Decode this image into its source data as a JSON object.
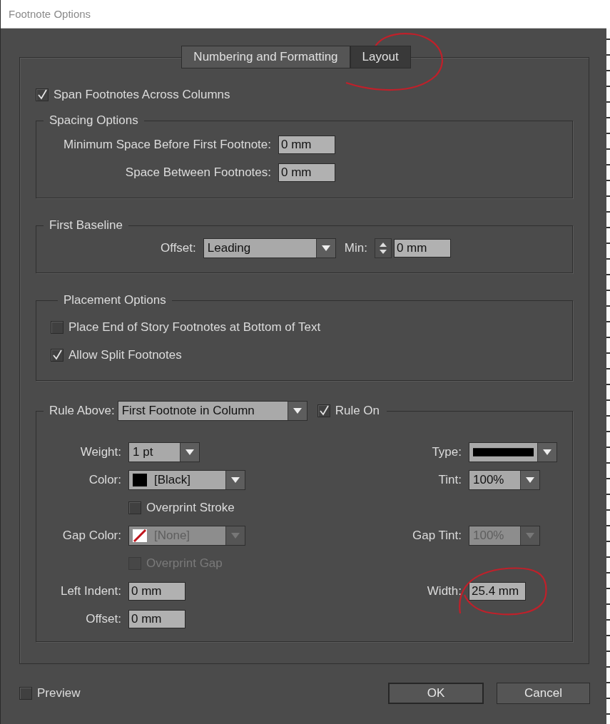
{
  "window": {
    "title": "Footnote Options"
  },
  "tabs": [
    {
      "label": "Numbering and Formatting",
      "selected": false
    },
    {
      "label": "Layout",
      "selected": true
    }
  ],
  "span_footnotes": {
    "label": "Span Footnotes Across Columns",
    "checked": true
  },
  "spacing_options": {
    "title": "Spacing Options",
    "fields": [
      {
        "label": "Minimum Space Before First Footnote:",
        "value": "0 mm"
      },
      {
        "label": "Space Between Footnotes:",
        "value": "0 mm"
      }
    ]
  },
  "first_baseline": {
    "title": "First Baseline",
    "offset": {
      "label": "Offset:",
      "value": "Leading"
    },
    "min": {
      "label": "Min:",
      "value": "0 mm"
    }
  },
  "placement_options": {
    "title": "Placement Options",
    "checkboxes": [
      {
        "label": "Place End of Story Footnotes at Bottom of Text",
        "checked": false
      },
      {
        "label": "Allow Split Footnotes",
        "checked": true
      }
    ]
  },
  "rule_above": {
    "label": "Rule Above:",
    "value": "First Footnote in Column",
    "rule_on": {
      "label": "Rule On",
      "checked": true
    },
    "rows": [
      {
        "left": {
          "kind": "dropdown",
          "label": "Weight:",
          "value": "1 pt",
          "disabled": false
        },
        "right": {
          "kind": "line-dropdown",
          "label": "Type:",
          "disabled": false
        }
      },
      {
        "left": {
          "kind": "dropdown",
          "label": "Color:",
          "value": "[Black]",
          "color": "#000000",
          "disabled": false
        },
        "right": {
          "kind": "dropdown",
          "label": "Tint:",
          "value": "100%",
          "disabled": false
        }
      },
      {
        "left": {
          "kind": "checkbox",
          "label": "Overprint Stroke",
          "checked": false,
          "disabled": false
        }
      },
      {
        "left": {
          "kind": "dropdown",
          "label": "Gap Color:",
          "value": "[None]",
          "swatch_none": true,
          "disabled": true
        },
        "right": {
          "kind": "dropdown",
          "label": "Gap Tint:",
          "value": "100%",
          "disabled": true
        }
      },
      {
        "left": {
          "kind": "checkbox",
          "label": "Overprint Gap",
          "checked": false,
          "disabled": true
        }
      },
      {
        "left": {
          "kind": "field",
          "label": "Left Indent:",
          "value": "0 mm"
        },
        "right": {
          "kind": "field",
          "label": "Width:",
          "value": "25.4 mm"
        }
      },
      {
        "left": {
          "kind": "field",
          "label": "Offset:",
          "value": "0 mm"
        }
      }
    ]
  },
  "preview": {
    "label": "Preview",
    "checked": false
  },
  "buttons": [
    {
      "label": "OK",
      "default": true
    },
    {
      "label": "Cancel",
      "default": false
    }
  ]
}
